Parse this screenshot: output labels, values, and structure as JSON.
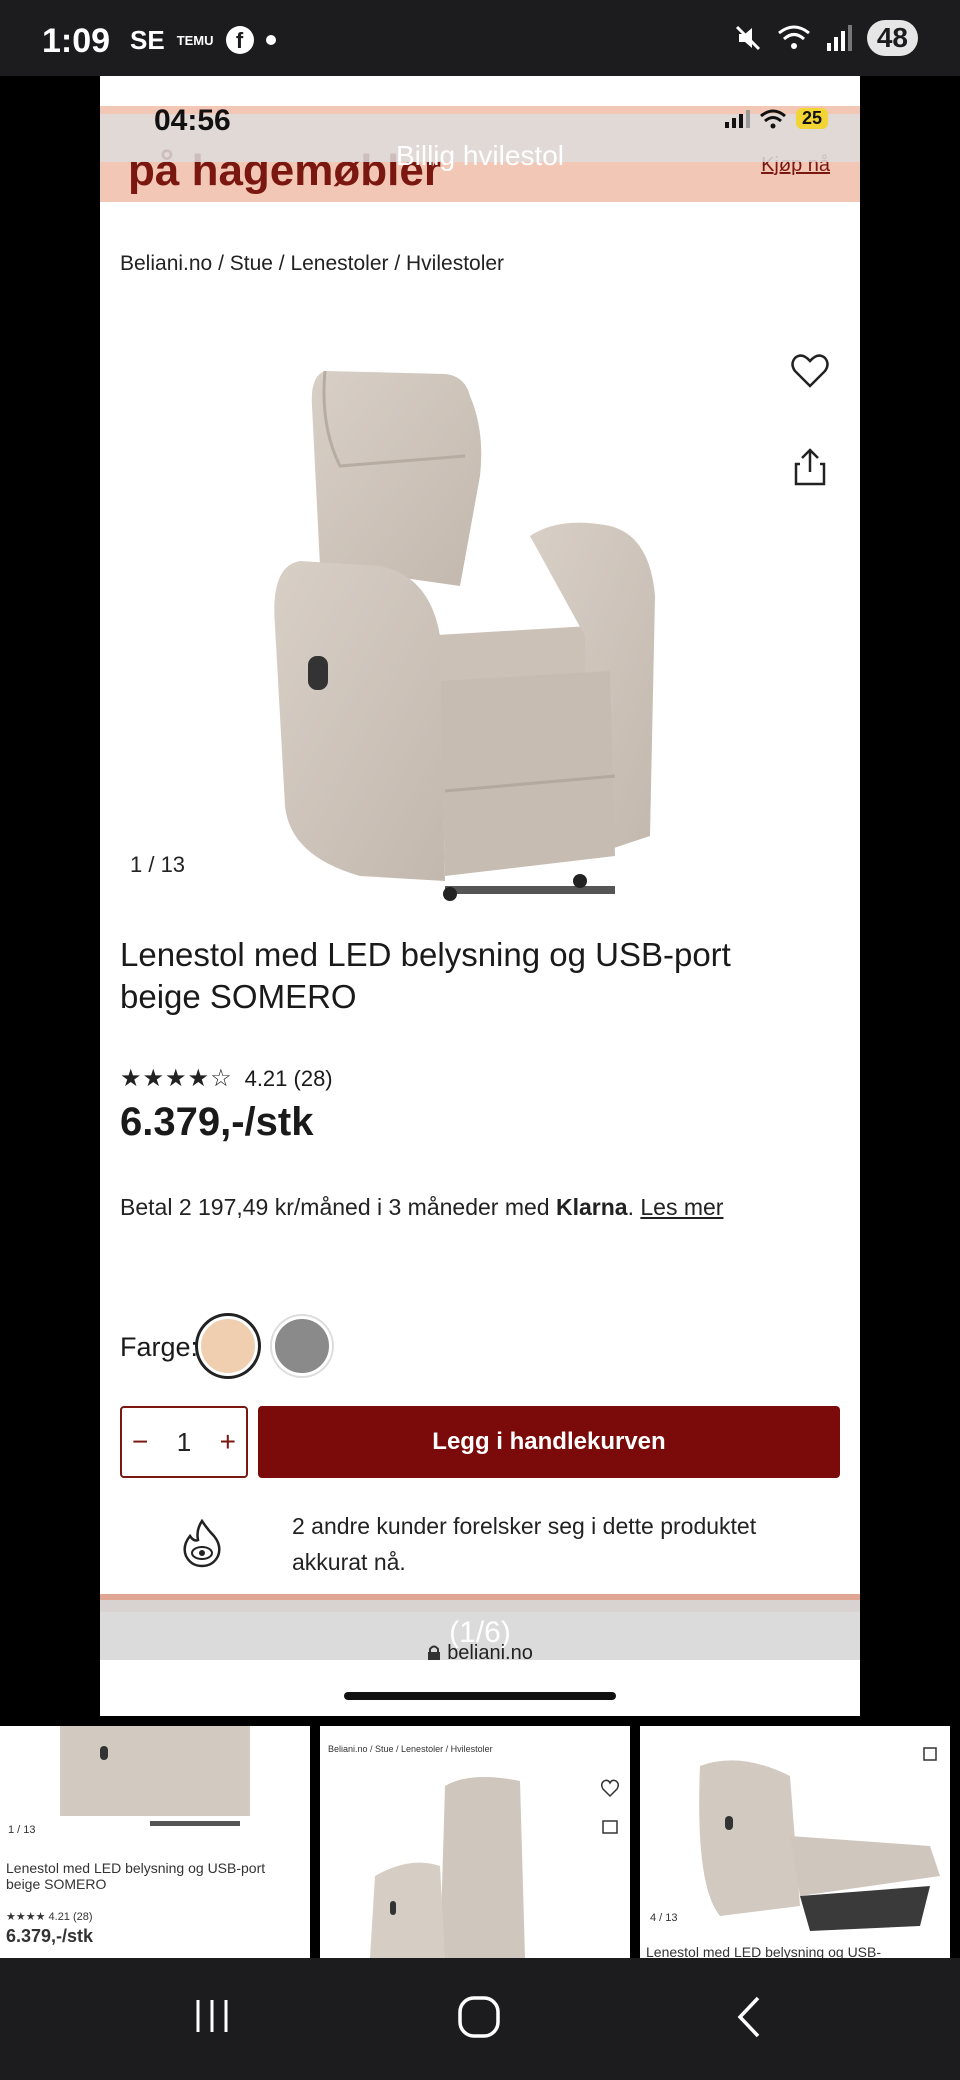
{
  "os_status": {
    "time": "1:09",
    "apps": [
      "SE",
      "TEMU"
    ],
    "battery": "48"
  },
  "inner_status": {
    "time": "04:56",
    "battery": "25"
  },
  "overlay_title": "Billig hvilestol",
  "promo": {
    "text": "på hagemøbler",
    "link": "Kjøp nå"
  },
  "breadcrumb": "Beliani.no / Stue / Lenestoler / Hvilestoler",
  "image_counter": "1 / 13",
  "product": {
    "title": "Lenestol med LED belysning og USB-port beige SOMERO",
    "rating_value": 4.21,
    "rating_text": "4.21 (28)",
    "price": "6.379,-/stk"
  },
  "klarna": {
    "text_before": "Betal 2 197,49 kr/måned i 3 måneder med ",
    "brand": "Klarna",
    "dot": ".",
    "link": "Les mer"
  },
  "color": {
    "label": "Farge:",
    "swatches": [
      {
        "name": "beige",
        "hex": "#efcfb0",
        "selected": true
      },
      {
        "name": "grey",
        "hex": "#8a8a8a",
        "selected": false
      }
    ]
  },
  "cart": {
    "qty_minus": "−",
    "qty_value": "1",
    "qty_plus": "+",
    "add_label": "Legg i handlekurven"
  },
  "social_proof": "2 andre kunder forelsker seg i dette produktet akkurat nå.",
  "page_indicator": "(1/6)",
  "url": "beliani.no",
  "thumbs": [
    {
      "counter": "1 / 13",
      "title": "Lenestol med LED belysning og USB-port beige SOMERO",
      "rating": "4.21 (28)",
      "price": "6.379,-/stk"
    },
    {
      "breadcrumb": "Beliani.no / Stue / Lenestoler / Hvilestoler"
    },
    {
      "counter": "4 / 13",
      "title": "Lenestol med LED belysning og USB-"
    }
  ],
  "colors": {
    "brand": "#7b0a0a",
    "promo": "#f3c7b5"
  },
  "icons": [
    "heart-icon",
    "share-icon",
    "lock-icon",
    "fire-eye-icon",
    "recents-icon",
    "home-icon",
    "back-icon"
  ]
}
